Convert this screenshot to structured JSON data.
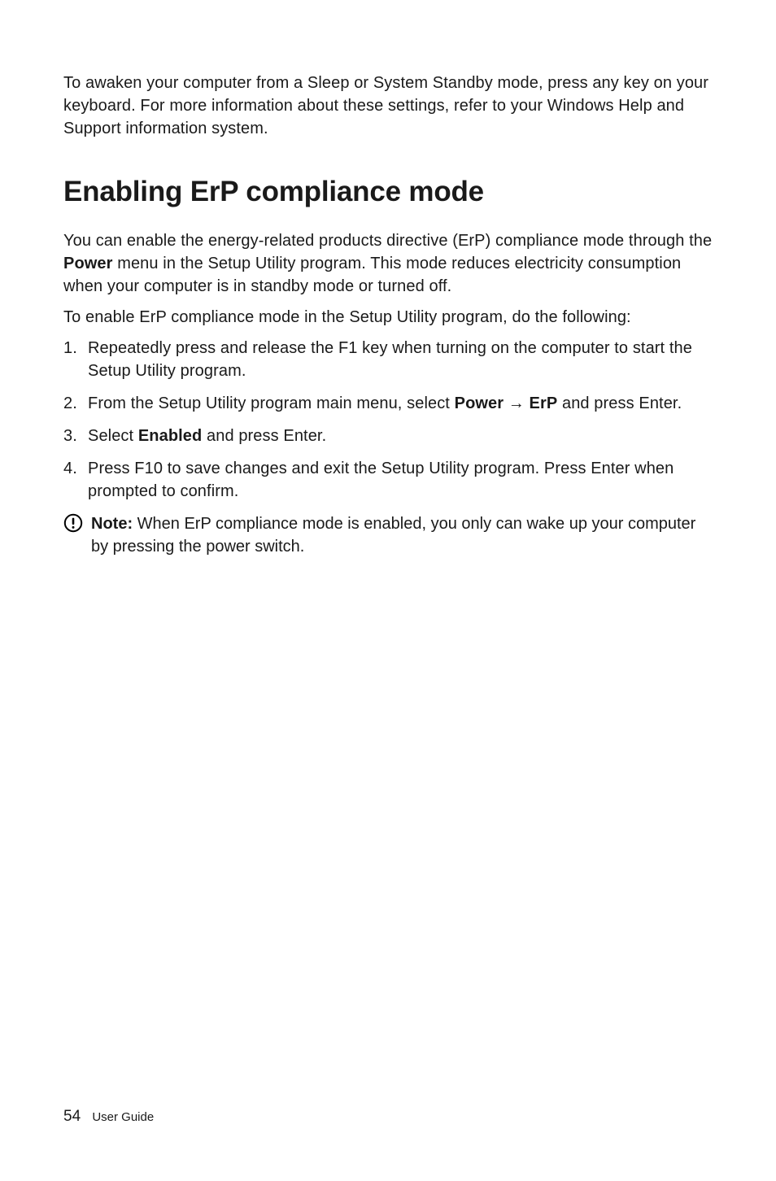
{
  "intro": "To awaken your computer from a Sleep or System Standby mode, press any key on your keyboard. For more information about these settings, refer to your Windows Help and Support information system.",
  "heading": "Enabling ErP compliance mode",
  "para1_a": "You can enable the energy-related products directive (ErP) compliance mode through the ",
  "para1_bold": "Power",
  "para1_b": " menu in the Setup Utility program. This mode reduces electricity consumption when your computer is in standby mode or turned off.",
  "para2": "To enable ErP compliance mode in the Setup Utility program, do the following:",
  "steps": {
    "s1": "Repeatedly press and release the F1 key when turning on the computer to start the Setup Utility program.",
    "s2_a": "From the Setup Utility program main menu, select ",
    "s2_bold": "Power → ErP",
    "s2_b": " and press Enter.",
    "s3_a": "Select ",
    "s3_bold": "Enabled",
    "s3_b": " and press Enter.",
    "s4": "Press F10 to save changes and exit the Setup Utility program. Press Enter when prompted to confirm."
  },
  "note": {
    "label": "Note:",
    "text": " When ErP compliance mode is enabled, you only can wake up your computer by pressing the power switch."
  },
  "footer": {
    "page": "54",
    "title": "User Guide"
  }
}
